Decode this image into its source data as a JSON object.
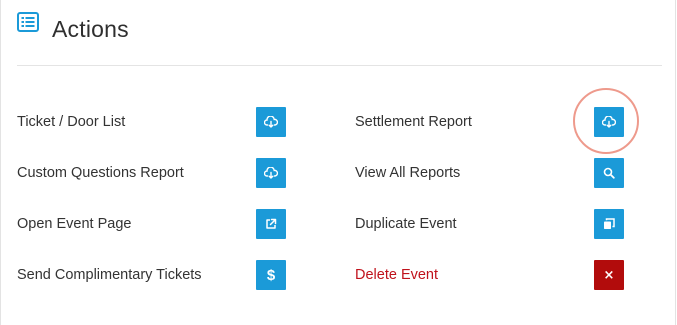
{
  "header": {
    "title": "Actions",
    "icon": "list-icon",
    "icon_color": "#1b9ad8"
  },
  "actions_left": [
    {
      "label": "Ticket / Door List",
      "icon": "cloud-download-icon"
    },
    {
      "label": "Custom Questions Report",
      "icon": "cloud-download-icon"
    },
    {
      "label": "Open Event Page",
      "icon": "external-link-icon"
    },
    {
      "label": "Send Complimentary Tickets",
      "icon": "dollar-icon",
      "symbol": "$"
    }
  ],
  "actions_right": [
    {
      "label": "Settlement Report",
      "icon": "cloud-download-icon",
      "highlighted": true
    },
    {
      "label": "View All Reports",
      "icon": "search-icon"
    },
    {
      "label": "Duplicate Event",
      "icon": "copy-icon"
    },
    {
      "label": "Delete Event",
      "icon": "close-icon",
      "symbol": "×",
      "danger": true
    }
  ],
  "colors": {
    "button": "#1b9ad8",
    "danger_button": "#b20c0c",
    "danger_text": "#c0121c",
    "highlight_ring": "#ee9a8c"
  }
}
